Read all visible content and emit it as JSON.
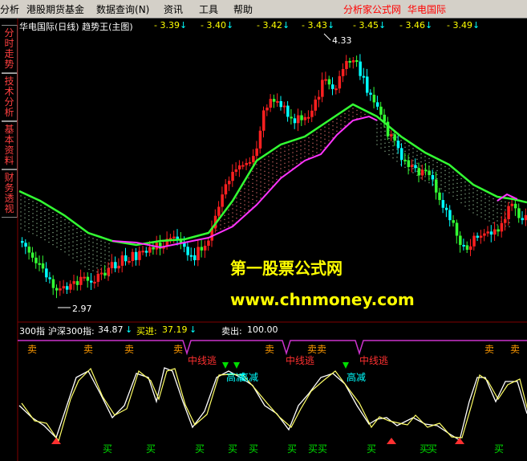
{
  "menu": {
    "items": [
      "分析",
      "港股期货基金",
      "数据查询",
      "资讯",
      "工具",
      "帮助"
    ],
    "query_suffix": "(N)",
    "right_links": [
      "分析家公式网",
      "华电国际"
    ]
  },
  "sidetabs": [
    "分时走势",
    "技术分析",
    "基本资料",
    "财务透视"
  ],
  "main_chart": {
    "title": "华电国际(日线) 趋势王(主图)",
    "price_tags": [
      "3.39",
      "3.40",
      "3.42",
      "3.43",
      "3.45",
      "3.46",
      "3.49"
    ],
    "high_label": "4.33",
    "low_label": "2.97"
  },
  "watermark": {
    "line1": "第一股票公式网",
    "line2": "www.chnmoney.com"
  },
  "sub_panel": {
    "index_label": "300指",
    "index_name": "沪深300指:",
    "index_value": "34.87",
    "buy_label": "买进:",
    "buy_value": "37.19",
    "sell_label": "卖出:",
    "sell_value": "100.00",
    "sell_marks": [
      "卖",
      "卖",
      "卖",
      "卖",
      "卖",
      "卖",
      "卖卖",
      "卖",
      "卖"
    ],
    "zhong_marks": [
      "中线逃",
      "中线逃",
      "中线逃"
    ],
    "gao_marks": [
      "高减",
      "高减",
      "高减"
    ],
    "buy_marks": [
      "买",
      "买",
      "买",
      "买",
      "买",
      "买",
      "买",
      "买",
      "买",
      "买",
      "买",
      "买",
      "买"
    ]
  },
  "colors": {
    "up": "#ff2020",
    "down": "#00ffff",
    "green_line": "#33ff33",
    "magenta_line": "#ff33ff",
    "yellow": "#ffff00"
  }
}
